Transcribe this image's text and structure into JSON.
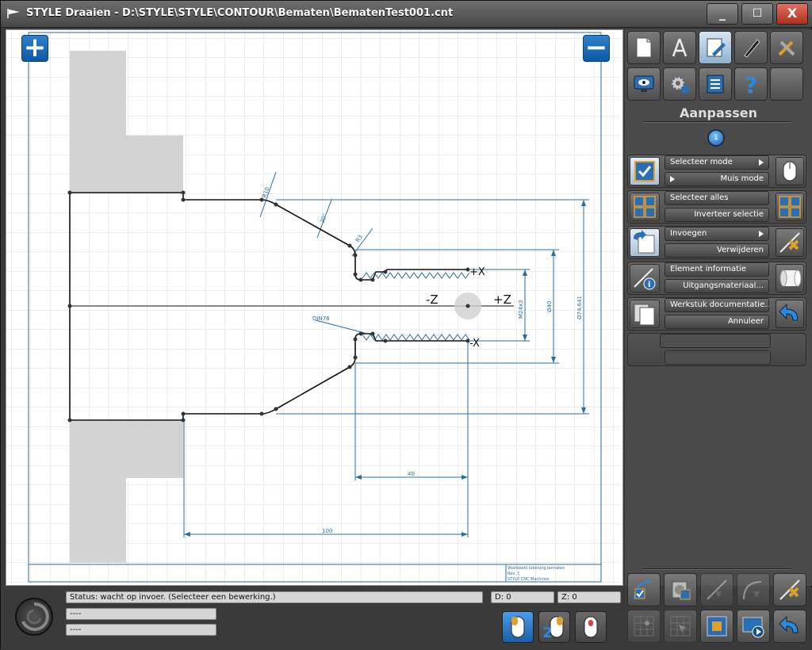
{
  "window": {
    "title": "STYLE Draaien - D:\\STYLE\\STYLE\\CONTOUR\\Bematen\\BematenTest001.cnt",
    "minimize": "_",
    "maximize": "☐",
    "close": "X"
  },
  "canvas": {
    "zoom_in": "+",
    "zoom_out": "−",
    "axis_minus_z": "-Z",
    "axis_plus_z": "+Z",
    "axis_x_top": "+X",
    "axis_x_bottom": "-X",
    "dims": {
      "r10": "R10",
      "angle30": "30°",
      "r3": "R3",
      "din76": "DIN76",
      "thread": "M24x3",
      "dia40": "Ø40",
      "dia74": "Ø74.641",
      "len40": "40",
      "len100": "100"
    },
    "title_block": [
      "Voorbeeld tekening bematen",
      "Rev. 1",
      "STYLE CNC Machines"
    ]
  },
  "sidebar": {
    "section_title": "Aanpassen",
    "page_number": "1",
    "groups": [
      {
        "top": "Selecteer mode",
        "bottom": "Muis mode"
      },
      {
        "top": "Selecteer alles",
        "bottom": "Inverteer selectie"
      },
      {
        "top": "Invoegen",
        "bottom": "Verwijderen"
      },
      {
        "top": "Element informatie",
        "bottom": "Uitgangsmateriaal..."
      },
      {
        "top": "Werkstuk documentatie...",
        "bottom": "Annuleer"
      }
    ]
  },
  "status": {
    "line1": "Status: wacht op invoer. (Selecteer een bewerking.)",
    "line2": "----",
    "line3": "----",
    "d_value": "D: 0",
    "z_value": "Z: 0"
  },
  "mouse_buttons": {
    "second_label": "2"
  },
  "colors": {
    "accent": "#1a6fbf",
    "dimension_line": "#2b6d9c",
    "stock": "#d3d3d3",
    "contour": "#111111"
  }
}
